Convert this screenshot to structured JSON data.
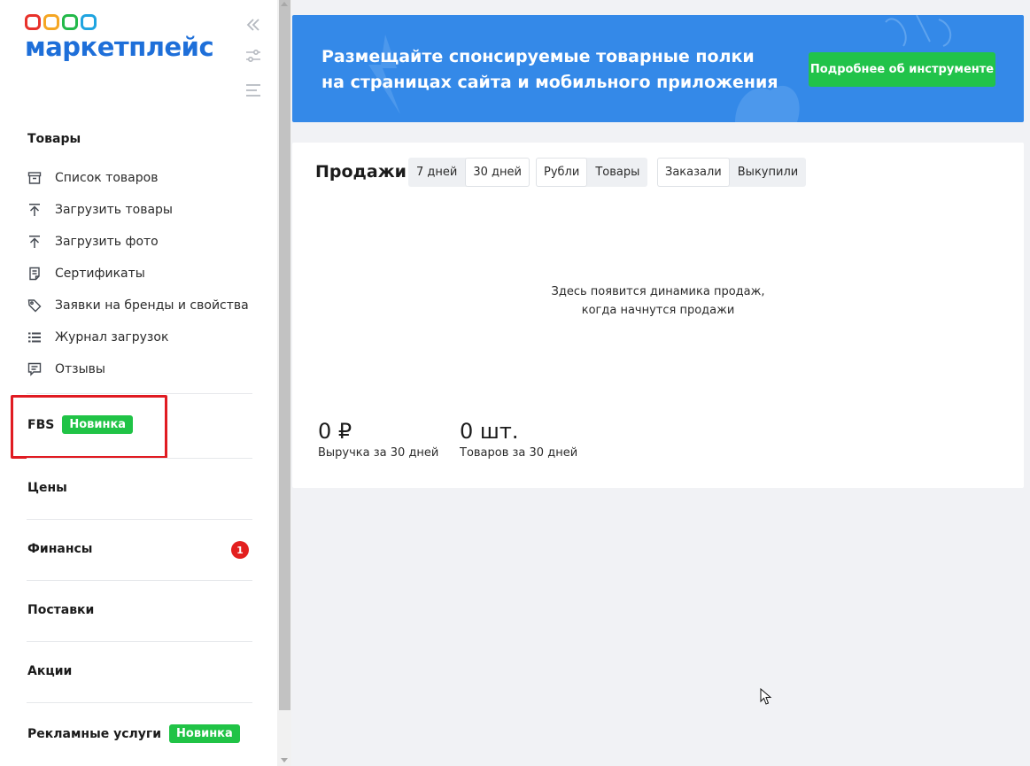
{
  "logo": {
    "text": "маркетплейс",
    "ring_colors": [
      "#e8322b",
      "#f5a623",
      "#23b94a",
      "#1fa4e0"
    ]
  },
  "brand_color": "#1e6fd9",
  "sidebar": {
    "goods_title": "Товары",
    "items": [
      {
        "label": "Список товаров",
        "icon": "archive-box-icon"
      },
      {
        "label": "Загрузить товары",
        "icon": "upload-arrow-icon"
      },
      {
        "label": "Загрузить фото",
        "icon": "upload-arrow-icon"
      },
      {
        "label": "Сертификаты",
        "icon": "document-icon"
      },
      {
        "label": "Заявки на бренды и свойства",
        "icon": "tag-icon"
      },
      {
        "label": "Журнал загрузок",
        "icon": "list-icon"
      },
      {
        "label": "Отзывы",
        "icon": "comment-icon"
      }
    ],
    "fbs": {
      "label": "FBS",
      "badge": "Новинка"
    },
    "prices": "Цены",
    "finance": {
      "label": "Финансы",
      "count": "1"
    },
    "supplies": "Поставки",
    "promos": "Акции",
    "ads": {
      "label": "Рекламные услуги",
      "badge": "Новинка"
    }
  },
  "banner": {
    "line1": "Размещайте спонсируемые товарные полки",
    "line2": "на страницах сайта и мобильного приложения",
    "button": "Подробнее об инструменте",
    "bg_color": "#3489e8",
    "button_color": "#21c34a"
  },
  "sales": {
    "title": "Продажи",
    "period_tabs": [
      {
        "label": "7 дней",
        "active": false
      },
      {
        "label": "30 дней",
        "active": true
      }
    ],
    "unit_tabs": [
      {
        "label": "Рубли",
        "active": true
      },
      {
        "label": "Товары",
        "active": false
      }
    ],
    "type_tabs": [
      {
        "label": "Заказали",
        "active": true
      },
      {
        "label": "Выкупили",
        "active": false
      }
    ],
    "empty_line1": "Здесь появится динамика продаж,",
    "empty_line2": "когда начнутся продажи",
    "revenue": {
      "value": "0 ₽",
      "label": "Выручка за 30 дней"
    },
    "items": {
      "value": "0 шт.",
      "label": "Товаров за 30 дней"
    }
  },
  "new_badge_color": "#20c346",
  "alert_color": "#e3201f"
}
